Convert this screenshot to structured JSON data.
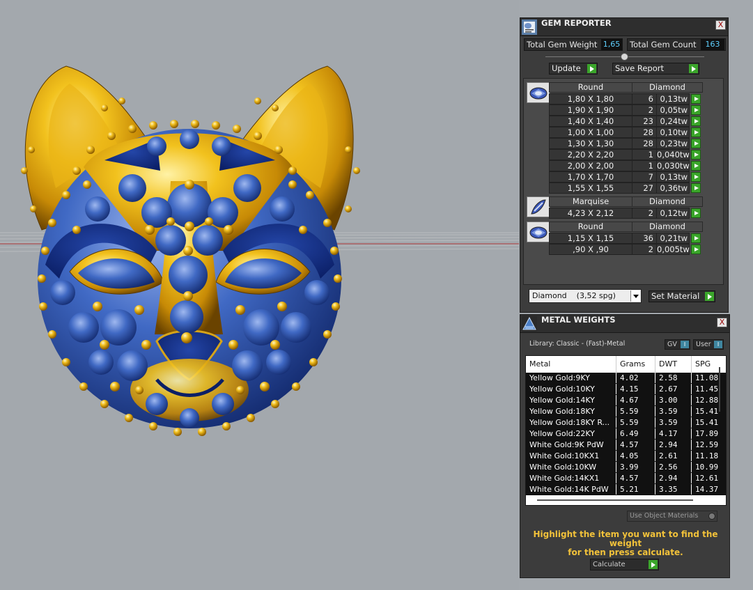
{
  "gem_reporter": {
    "title": "GEM REPORTER",
    "close": "X",
    "total_weight_label": "Total Gem Weight",
    "total_weight_value": "1,65",
    "total_count_label": "Total Gem Count",
    "total_count_value": "163",
    "update_label": "Update",
    "save_report_label": "Save Report",
    "groups": [
      {
        "shape": "Round",
        "material": "Diamond",
        "rows": [
          {
            "size": "1,80 X 1,80",
            "count": "6",
            "weight": "0,13tw"
          },
          {
            "size": "1,90 X 1,90",
            "count": "2",
            "weight": "0,05tw"
          },
          {
            "size": "1,40 X 1,40",
            "count": "23",
            "weight": "0,24tw"
          },
          {
            "size": "1,00 X 1,00",
            "count": "28",
            "weight": "0,10tw"
          },
          {
            "size": "1,30 X 1,30",
            "count": "28",
            "weight": "0,23tw"
          },
          {
            "size": "2,20 X 2,20",
            "count": "1",
            "weight": "0,040tw"
          },
          {
            "size": "2,00 X 2,00",
            "count": "1",
            "weight": "0,030tw"
          },
          {
            "size": "1,70 X 1,70",
            "count": "7",
            "weight": "0,13tw"
          },
          {
            "size": "1,55 X 1,55",
            "count": "27",
            "weight": "0,36tw"
          }
        ]
      },
      {
        "shape": "Marquise",
        "material": "Diamond",
        "rows": [
          {
            "size": "4,23 X 2,12",
            "count": "2",
            "weight": "0,12tw"
          }
        ]
      },
      {
        "shape": "Round",
        "material": "Diamond",
        "rows": [
          {
            "size": "1,15 X 1,15",
            "count": "36",
            "weight": "0,21tw"
          },
          {
            "size": ",90 X ,90",
            "count": "2",
            "weight": "0,005tw"
          }
        ]
      }
    ],
    "material_select_value": "Diamond    (3,52 spg)",
    "set_material_label": "Set Material"
  },
  "metal_weights": {
    "title": "METAL WEIGHTS",
    "close": "X",
    "library_label": "Library: Classic - (Fast)-Metal",
    "gv_label": "GV",
    "user_label": "User",
    "toggle_indicator": "I",
    "columns": [
      "Metal",
      "Grams",
      "DWT",
      "SPG"
    ],
    "rows": [
      [
        "Yellow Gold:9KY",
        "4.02",
        "2.58",
        "11.08"
      ],
      [
        "Yellow Gold:10KY",
        "4.15",
        "2.67",
        "11.45"
      ],
      [
        "Yellow Gold:14KY",
        "4.67",
        "3.00",
        "12.88"
      ],
      [
        "Yellow Gold:18KY",
        "5.59",
        "3.59",
        "15.41"
      ],
      [
        "Yellow Gold:18KY R...",
        "5.59",
        "3.59",
        "15.41"
      ],
      [
        "Yellow Gold:22KY",
        "6.49",
        "4.17",
        "17.89"
      ],
      [
        "White Gold:9K PdW",
        "4.57",
        "2.94",
        "12.59"
      ],
      [
        "White Gold:10KX1",
        "4.05",
        "2.61",
        "11.18"
      ],
      [
        "White Gold:10KW",
        "3.99",
        "2.56",
        "10.99"
      ],
      [
        "White Gold:14KX1",
        "4.57",
        "2.94",
        "12.61"
      ],
      [
        "White Gold:14K PdW",
        "5.21",
        "3.35",
        "14.37"
      ]
    ],
    "use_object_materials_label": "Use Object Materials",
    "hint_line1": "Highlight the item you want to find the weight",
    "hint_line2": "for then press calculate.",
    "calculate_label": "Calculate"
  },
  "colors": {
    "panel_bg": "#3c3c3c",
    "viewport_bg": "#a3a8ad",
    "accent_green": "#3aa52a",
    "value_blue": "#5fd0ff",
    "hint_yellow": "#f2c23a",
    "gold": "#d9a514",
    "sapphire": "#1d3f9a"
  },
  "icons": {
    "gem_reporter": "gem-reporter-app-icon",
    "metal_weights": "metal-weights-app-icon",
    "round_gem": "round-gem-icon",
    "marquise_gem": "marquise-gem-icon",
    "arrow": "green-arrow-icon"
  }
}
